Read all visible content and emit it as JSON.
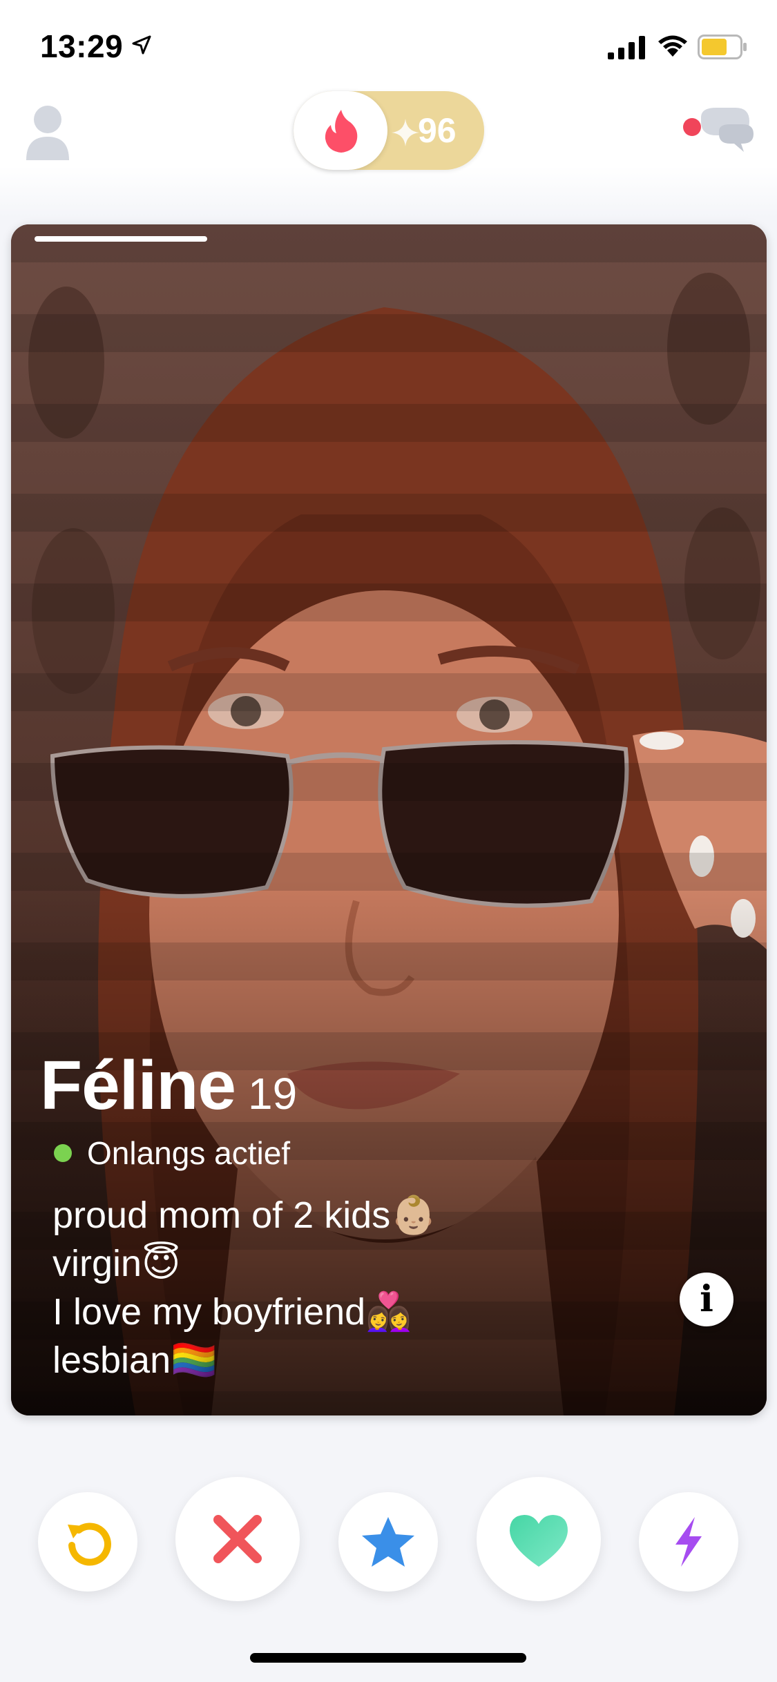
{
  "status_bar": {
    "time": "13:29"
  },
  "top_nav": {
    "boost_count": "96"
  },
  "card": {
    "name": "Féline",
    "age": "19",
    "activity_status": "Onlangs actief",
    "bio_lines": [
      "proud mom of 2 kids👶🏼",
      "virgin😇",
      "I love my boyfriend👩‍❤️‍👩",
      "lesbian🏳️‍🌈"
    ],
    "info_label": "i",
    "photo_count_indicator": 1
  },
  "actions": [
    {
      "name": "rewind",
      "icon": "rewind-icon",
      "color": "#f5b700"
    },
    {
      "name": "nope",
      "icon": "close-icon",
      "color": "#f0555a"
    },
    {
      "name": "super-like",
      "icon": "star-icon",
      "color": "#3a8fe8"
    },
    {
      "name": "like",
      "icon": "heart-icon",
      "color": "#4fe0b0"
    },
    {
      "name": "boost",
      "icon": "lightning-icon",
      "color": "#a64cf0"
    }
  ],
  "colors": {
    "brand_flame": "#fd4f68",
    "gold": "#ecd79a",
    "active_green": "#7bd250",
    "notification_dot": "#f0455a"
  }
}
